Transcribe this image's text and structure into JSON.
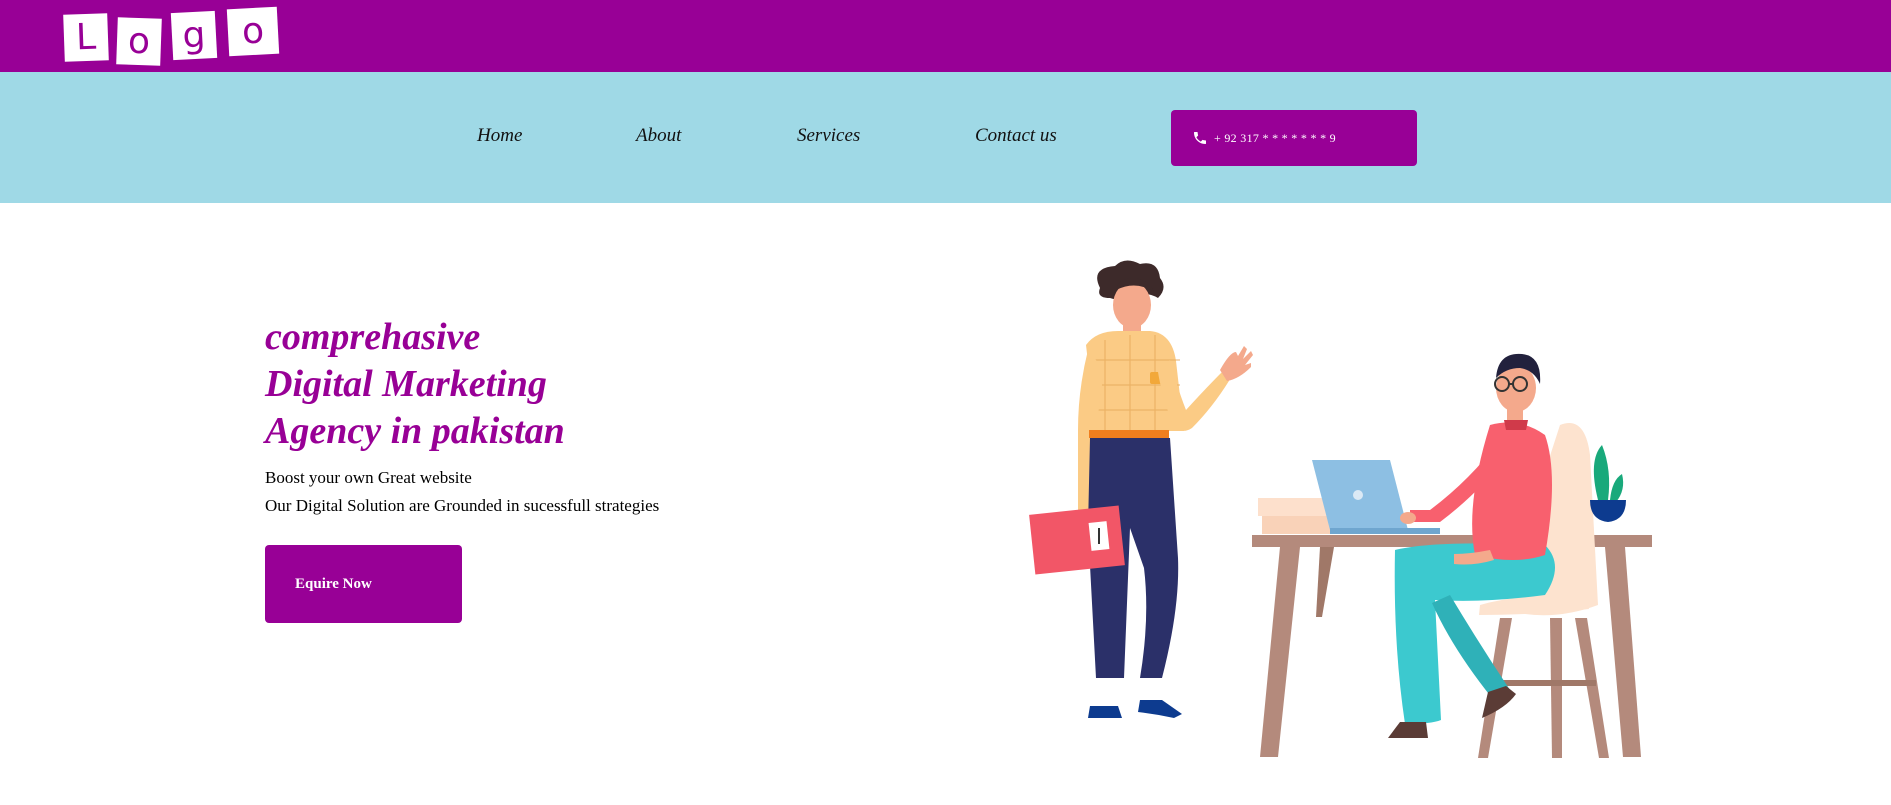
{
  "header": {
    "logo_letters": [
      "L",
      "o",
      "g",
      "o"
    ],
    "logo_name": "Logo",
    "brand_color": "#980096"
  },
  "nav": {
    "background": "#9fd9e6",
    "items": [
      {
        "label": "Home"
      },
      {
        "label": "About"
      },
      {
        "label": "Services"
      },
      {
        "label": "Contact us"
      }
    ],
    "phone": {
      "icon": "phone-icon",
      "text": "+ 92 317 * * * * * * * 9"
    }
  },
  "hero": {
    "title_lines": [
      "comprehasive",
      "Digital Marketing",
      "Agency in pakistan"
    ],
    "subtitle_lines": [
      "Boost your own Great website",
      "Our Digital Solution are Grounded in sucessfull strategies"
    ],
    "cta_label": "Equire Now"
  },
  "illustration": {
    "name": "office-team-illustration"
  }
}
